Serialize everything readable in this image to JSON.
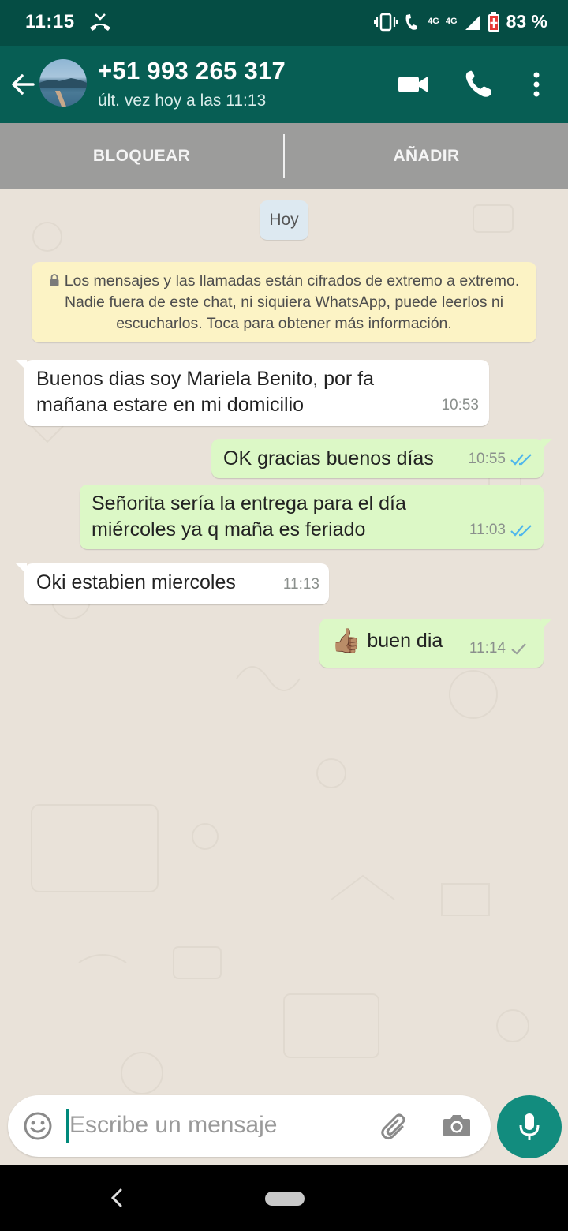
{
  "status_bar": {
    "time": "11:15",
    "battery_percent": "83 %",
    "network_label_1": "4G",
    "network_label_2": "4G",
    "icons": [
      "missed-call-icon",
      "vibrate-icon",
      "wifi-calling-icon",
      "signal-icon",
      "battery-icon"
    ]
  },
  "header": {
    "contact_name": "+51 993 265 317",
    "last_seen": "últ. vez hoy a las 11:13",
    "icons": [
      "back-arrow-icon",
      "video-call-icon",
      "phone-call-icon",
      "more-options-icon"
    ],
    "accent_color": "#075e54"
  },
  "action_bar": {
    "block_label": "BLOQUEAR",
    "add_label": "AÑADIR"
  },
  "chat": {
    "date_chip": "Hoy",
    "encryption_notice": "Los mensajes y las llamadas están cifrados de extremo a extremo. Nadie fuera de este chat, ni siquiera WhatsApp, puede leerlos ni escucharlos. Toca para obtener más información.",
    "messages": [
      {
        "direction": "in",
        "lines": [
          "Buenos dias soy Mariela Benito, por fa",
          "mañana estare en mi domicilio"
        ],
        "time": "10:53"
      },
      {
        "direction": "out",
        "lines": [
          "OK gracias buenos días"
        ],
        "time": "10:55",
        "status": "read"
      },
      {
        "direction": "out",
        "lines": [
          "Señorita sería la entrega para el día",
          "miércoles ya q maña es feriado"
        ],
        "time": "11:03",
        "status": "read"
      },
      {
        "direction": "in",
        "lines": [
          "Oki estabien miercoles"
        ],
        "time": "11:13"
      },
      {
        "direction": "out",
        "lines": [
          "buen dia"
        ],
        "emoji": "👍🏽",
        "time": "11:14",
        "status": "sent"
      }
    ],
    "incoming_bubble_color": "#ffffff",
    "outgoing_bubble_color": "#dcf8c6",
    "read_tick_color": "#4fb6ec"
  },
  "composer": {
    "placeholder": "Escribe un mensaje",
    "icons": [
      "emoji-icon",
      "attach-icon",
      "camera-icon",
      "mic-icon"
    ]
  }
}
